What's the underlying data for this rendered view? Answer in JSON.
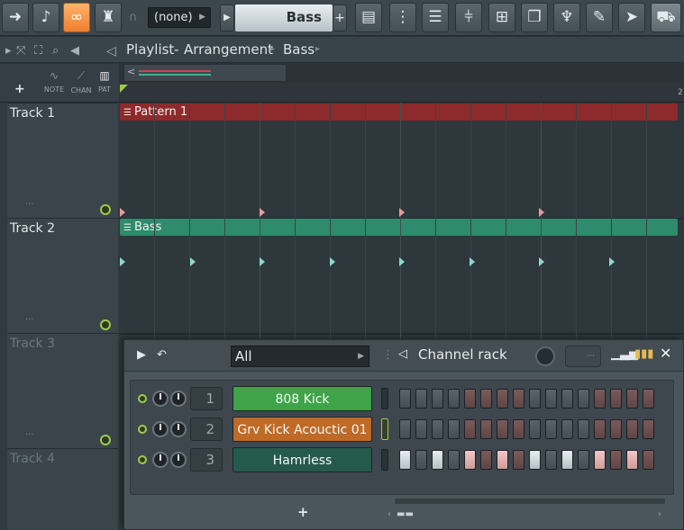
{
  "toolbar": {
    "icons": [
      "arrow-right-icon",
      "hint-icon",
      "link-icon",
      "metronome-icon",
      "magnet-icon",
      "playlist-icon",
      "piano-roll-icon",
      "browser-icon",
      "mixer-icon",
      "channel-rack-icon",
      "project-icon",
      "plugin-icon",
      "tempo-tap-icon",
      "help-icon",
      "shop-icon"
    ],
    "pattern_selector": "(none)",
    "pattern_name": "Bass",
    "add_label": "+"
  },
  "titlebar": {
    "breadcrumb": [
      "Playlist",
      "Arrangement",
      "Bass"
    ],
    "separator": "-"
  },
  "track_header": {
    "add_label": "+",
    "selectors": [
      {
        "label": "NOTE",
        "icon": "note-wave-icon"
      },
      {
        "label": "CHAN",
        "icon": "automation-icon"
      },
      {
        "label": "PAT",
        "icon": "pattern-icon"
      }
    ]
  },
  "ruler": {
    "bar_number": "2"
  },
  "tracks": [
    {
      "name": "Track 1",
      "dots": "...",
      "active": true
    },
    {
      "name": "Track 2",
      "dots": "...",
      "active": true
    },
    {
      "name": "Track 3",
      "dots": "...",
      "active": false
    },
    {
      "name": "Track 4",
      "dots": "",
      "active": false
    }
  ],
  "clips": [
    {
      "label": "Pattern 1",
      "color": "#8d2a2b"
    },
    {
      "label": "Bass",
      "color": "#2e8b6b"
    }
  ],
  "channel_rack": {
    "filter": "All",
    "title": "Channel rack",
    "swing": "···",
    "add_label": "+",
    "accent_colors": {
      "green": "#3ea349",
      "orange": "#bf6a26",
      "teal": "#245a4b"
    },
    "channels": [
      {
        "number": "1",
        "name": "808 Kick",
        "color": "#3ea349",
        "selected": false,
        "steps": [
          0,
          0,
          0,
          0,
          0,
          0,
          0,
          0,
          0,
          0,
          0,
          0,
          0,
          0,
          0,
          0
        ]
      },
      {
        "number": "2",
        "name": "Grv Kick Acouctic 01",
        "color": "#bf6a26",
        "selected": true,
        "steps": [
          0,
          0,
          0,
          0,
          0,
          0,
          0,
          0,
          0,
          0,
          0,
          0,
          0,
          0,
          0,
          0
        ]
      },
      {
        "number": "3",
        "name": "Hamrless",
        "color": "#245a4b",
        "selected": false,
        "steps": [
          1,
          0,
          1,
          0,
          1,
          0,
          1,
          0,
          1,
          0,
          1,
          0,
          1,
          0,
          1,
          0
        ]
      }
    ]
  }
}
